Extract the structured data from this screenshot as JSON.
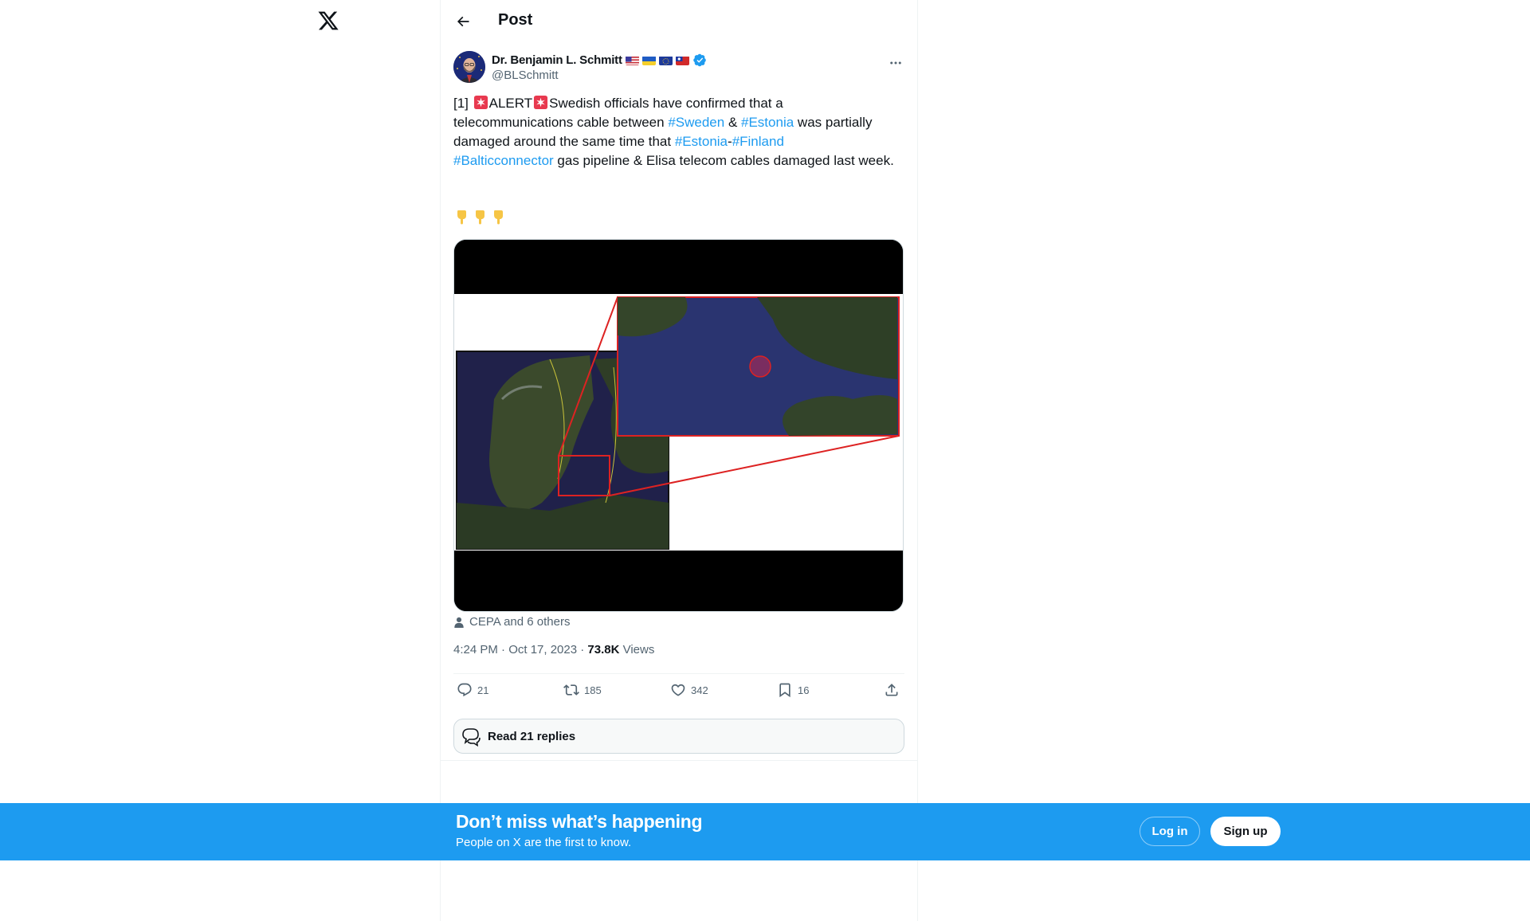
{
  "app": {
    "logo_icon": "x-logo-icon"
  },
  "header": {
    "title": "Post",
    "back_icon": "arrow-left-icon"
  },
  "post": {
    "author_name": "Dr. Benjamin L. Schmitt",
    "flags": [
      "us-flag-icon",
      "ukraine-flag-icon",
      "eu-flag-icon",
      "taiwan-flag-icon"
    ],
    "verified_icon": "verified-badge-icon",
    "handle": "@BLSchmitt",
    "text": {
      "p1": "[1] ",
      "p2": "ALERT",
      "p3": "Swedish officials have confirmed that a telecommunications cable between ",
      "tag_sweden": "#Sweden",
      "p4": " & ",
      "tag_estonia1": "#Estonia",
      "p5": " was partially damaged around the same time that ",
      "tag_estonia2": "#Estonia",
      "p6": "-",
      "tag_finland": "#Finland",
      "tag_balticconnector": "#Balticconnector",
      "p7": " gas pipeline & Elisa telecom cables damaged last week."
    },
    "emoji_row": [
      "backhand-index-pointing-down-icon",
      "backhand-index-pointing-down-icon",
      "backhand-index-pointing-down-icon"
    ],
    "liked_by": "CEPA and 6 others",
    "time": "4:24 PM · Oct 17, 2023 · ",
    "views_count": "73.8K",
    "views_label": " Views",
    "stats": {
      "replies": "21",
      "reposts": "185",
      "likes": "342",
      "bookmarks": "16"
    },
    "read_replies": "Read 21 replies"
  },
  "banner": {
    "title": "Don’t miss what’s happening",
    "subtitle": "People on X are the first to know.",
    "login": "Log in",
    "signup": "Sign up"
  },
  "colors": {
    "accent": "#1d9bf0",
    "text": "#0f1419",
    "muted": "#536471"
  }
}
